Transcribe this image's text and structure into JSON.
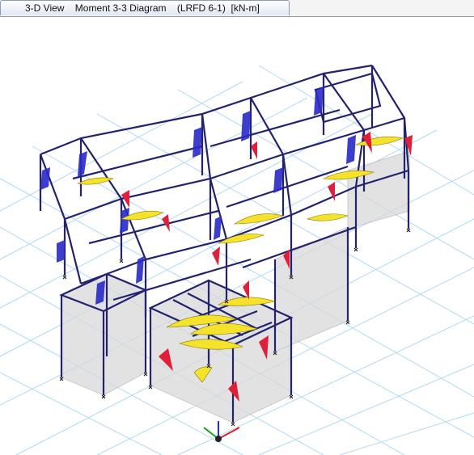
{
  "window": {
    "tab_title": "3-D View    Moment 3-3 Diagram    (LRFD 6-1)  [kN-m]"
  },
  "colors": {
    "background": "#ffffff",
    "grid": "#9ed0f0",
    "frame_member": "#1e1e6e",
    "positive_moment": "#f5e22a",
    "negative_moment": "#e0203a",
    "moment_fill_blue": "#2a2ac8",
    "wall_panel": "#dadada"
  },
  "icons": [
    "axis-triad-icon",
    "fixed-support-icon"
  ]
}
